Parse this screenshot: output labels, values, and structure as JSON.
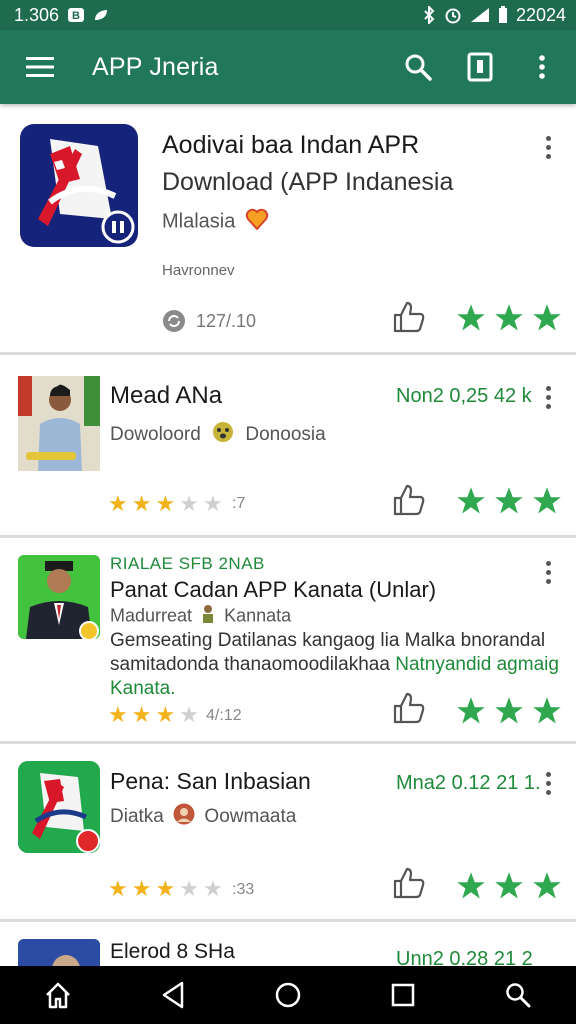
{
  "status_bar": {
    "time": "1.306",
    "clock": "22024"
  },
  "toolbar": {
    "title": "APP Jneria"
  },
  "items": [
    {
      "title": "Aodivai baa Indan APR",
      "subtitle": "Download (APP Indanesia",
      "region": "Mlalasia",
      "category": "Havronnev",
      "count": "127/.10"
    },
    {
      "title": "Mead ANa",
      "meta": "Non2 0,25 42  k",
      "sub": "Dowoloord",
      "sub2": "Donoosia",
      "rating_count": ":7"
    },
    {
      "tag": "RIALAE SFB 2NAB",
      "title": "Panat Cadan APP Kanata (Unlar)",
      "sub": "Madurreat",
      "sub2": "Kannata",
      "desc1": "Gemseating Datilanas kangaog lia Malka bnorandal",
      "desc2a": "samitadonda thanaomoodilakhaa",
      "desc2b": "Natnyandid agmaig",
      "desc3": "Kanata.",
      "rating_count": "4/:12"
    },
    {
      "title": "Pena: San Inbasian",
      "meta": "Mna2 0.12 21  1.",
      "sub": "Diatka",
      "sub2": "Oowmaata",
      "rating_count": ":33"
    },
    {
      "title": "Elerod 8 SHa",
      "meta": "Unn2 0.28 21  2"
    }
  ],
  "colors": {
    "toolbar": "#21775a",
    "status": "#1e6b4f",
    "star_green": "#2fa84f",
    "star_gold": "#f2b21b"
  },
  "icons": [
    "menu-icon",
    "search-icon",
    "bookmark-icon",
    "overflow-icon",
    "thumbs-up-icon",
    "star-icon",
    "home-icon",
    "back-icon",
    "circle-home-icon",
    "square-recents-icon",
    "search-nav-icon"
  ]
}
